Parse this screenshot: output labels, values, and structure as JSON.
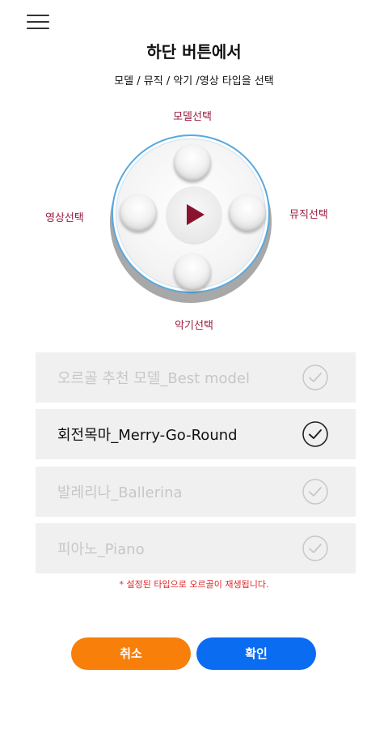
{
  "header": {
    "title": "하단 버튼에서",
    "subtitle": "모델 / 뮤직 / 악기 /영상 타입을 선택"
  },
  "selector": {
    "top_label": "모델선택",
    "left_label": "영상선택",
    "right_label": "뮤직선택",
    "bottom_label": "악기선택",
    "accent_color": "#9b1b3e",
    "ring_color": "#5aa9dc"
  },
  "options": [
    {
      "label": "오르골 추천 모델_Best model",
      "selected": false
    },
    {
      "label": "회전목마_Merry-Go-Round",
      "selected": true
    },
    {
      "label": "발레리나_Ballerina",
      "selected": false
    },
    {
      "label": "피아노_Piano",
      "selected": false
    }
  ],
  "notice": "* 설정된 타입으로 오르골이 재생됩니다.",
  "buttons": {
    "cancel_label": "취소",
    "ok_label": "확인",
    "cancel_color": "#f77f0a",
    "ok_color": "#0a6cf0"
  },
  "icons": [
    "menu-icon",
    "play-icon",
    "check-circle-icon"
  ]
}
